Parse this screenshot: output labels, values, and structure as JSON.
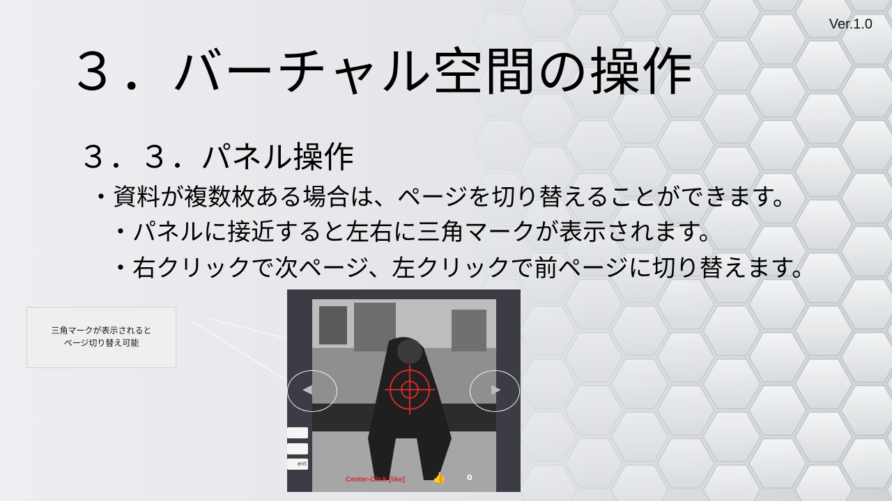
{
  "slide": {
    "version": "Ver.1.0",
    "title": "３．バーチャル空間の操作",
    "subtitle": "３．３．パネル操作",
    "bullets": [
      "・資料が複数枚ある場合は、ページを切り替えることができます。",
      "・パネルに接近すると左右に三角マークが表示されます。",
      "・右クリックで次ページ、左クリックで前ページに切り替えます。"
    ]
  },
  "callout": {
    "line1": "三角マークが表示されると",
    "line2": "ページ切り替え可能"
  },
  "screenshot": {
    "side_buttons": [
      "",
      "",
      "ent"
    ],
    "like_label": "Center-Click [like]",
    "like_icon": "thumbs-up-icon",
    "like_count": "0",
    "left_icon": "triangle-left-icon",
    "right_icon": "triangle-right-icon"
  },
  "colors": {
    "background": "#e9ebee",
    "screenshot_bg": "#3c3d44",
    "crosshair": "#d42a2a",
    "like_icon": "#3a6fd0"
  }
}
